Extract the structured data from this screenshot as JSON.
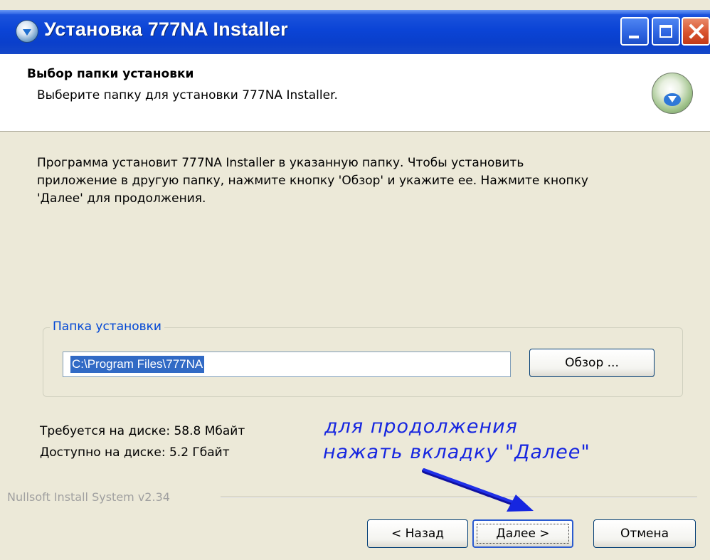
{
  "window": {
    "title": "Установка 777NA Installer"
  },
  "header": {
    "title": "Выбор папки установки",
    "subtitle": "Выберите папку для установки 777NA Installer."
  },
  "description": {
    "line1": "Программа установит 777NA Installer в указанную папку. Чтобы установить",
    "line2": "приложение в другую папку, нажмите кнопку 'Обзор' и укажите ее. Нажмите кнопку",
    "line3": "'Далее' для продолжения."
  },
  "install_folder": {
    "group_label": "Папка установки",
    "path_value": "C:\\Program Files\\777NA",
    "browse_label": "Обзор ..."
  },
  "disk": {
    "required": "Требуется на диске: 58.8 Мбайт",
    "available": "Доступно на диске: 5.2 Гбайт"
  },
  "annotation": {
    "line1": "для продолжения",
    "line2": "нажать вкладку \"Далее\"",
    "color": "#1626e0"
  },
  "footer": {
    "branding": "Nullsoft Install System v2.34",
    "back_label": "< Назад",
    "next_label": "Далее >",
    "cancel_label": "Отмена"
  },
  "colors": {
    "titlebar": "#0b44d6",
    "dialog_bg": "#ece9d8",
    "selection": "#316ac5",
    "group_label": "#0046d5"
  }
}
